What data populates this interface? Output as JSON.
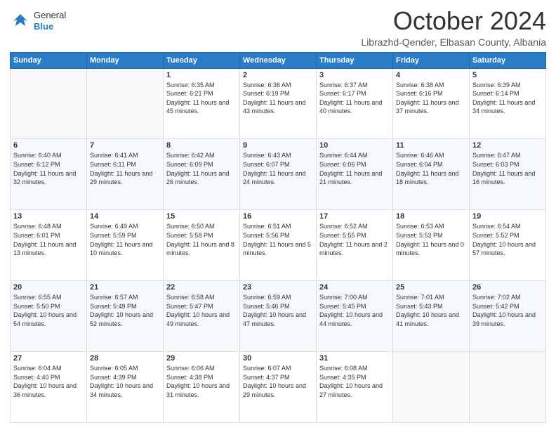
{
  "header": {
    "logo": {
      "general": "General",
      "blue": "Blue"
    },
    "month": "October 2024",
    "location": "Librazhd-Qender, Elbasan County, Albania"
  },
  "days_of_week": [
    "Sunday",
    "Monday",
    "Tuesday",
    "Wednesday",
    "Thursday",
    "Friday",
    "Saturday"
  ],
  "weeks": [
    [
      {
        "day": "",
        "info": ""
      },
      {
        "day": "",
        "info": ""
      },
      {
        "day": "1",
        "info": "Sunrise: 6:35 AM\nSunset: 6:21 PM\nDaylight: 11 hours and 45 minutes."
      },
      {
        "day": "2",
        "info": "Sunrise: 6:36 AM\nSunset: 6:19 PM\nDaylight: 11 hours and 43 minutes."
      },
      {
        "day": "3",
        "info": "Sunrise: 6:37 AM\nSunset: 6:17 PM\nDaylight: 11 hours and 40 minutes."
      },
      {
        "day": "4",
        "info": "Sunrise: 6:38 AM\nSunset: 6:16 PM\nDaylight: 11 hours and 37 minutes."
      },
      {
        "day": "5",
        "info": "Sunrise: 6:39 AM\nSunset: 6:14 PM\nDaylight: 11 hours and 34 minutes."
      }
    ],
    [
      {
        "day": "6",
        "info": "Sunrise: 6:40 AM\nSunset: 6:12 PM\nDaylight: 11 hours and 32 minutes."
      },
      {
        "day": "7",
        "info": "Sunrise: 6:41 AM\nSunset: 6:11 PM\nDaylight: 11 hours and 29 minutes."
      },
      {
        "day": "8",
        "info": "Sunrise: 6:42 AM\nSunset: 6:09 PM\nDaylight: 11 hours and 26 minutes."
      },
      {
        "day": "9",
        "info": "Sunrise: 6:43 AM\nSunset: 6:07 PM\nDaylight: 11 hours and 24 minutes."
      },
      {
        "day": "10",
        "info": "Sunrise: 6:44 AM\nSunset: 6:06 PM\nDaylight: 11 hours and 21 minutes."
      },
      {
        "day": "11",
        "info": "Sunrise: 6:46 AM\nSunset: 6:04 PM\nDaylight: 11 hours and 18 minutes."
      },
      {
        "day": "12",
        "info": "Sunrise: 6:47 AM\nSunset: 6:03 PM\nDaylight: 11 hours and 16 minutes."
      }
    ],
    [
      {
        "day": "13",
        "info": "Sunrise: 6:48 AM\nSunset: 6:01 PM\nDaylight: 11 hours and 13 minutes."
      },
      {
        "day": "14",
        "info": "Sunrise: 6:49 AM\nSunset: 5:59 PM\nDaylight: 11 hours and 10 minutes."
      },
      {
        "day": "15",
        "info": "Sunrise: 6:50 AM\nSunset: 5:58 PM\nDaylight: 11 hours and 8 minutes."
      },
      {
        "day": "16",
        "info": "Sunrise: 6:51 AM\nSunset: 5:56 PM\nDaylight: 11 hours and 5 minutes."
      },
      {
        "day": "17",
        "info": "Sunrise: 6:52 AM\nSunset: 5:55 PM\nDaylight: 11 hours and 2 minutes."
      },
      {
        "day": "18",
        "info": "Sunrise: 6:53 AM\nSunset: 5:53 PM\nDaylight: 11 hours and 0 minutes."
      },
      {
        "day": "19",
        "info": "Sunrise: 6:54 AM\nSunset: 5:52 PM\nDaylight: 10 hours and 57 minutes."
      }
    ],
    [
      {
        "day": "20",
        "info": "Sunrise: 6:55 AM\nSunset: 5:50 PM\nDaylight: 10 hours and 54 minutes."
      },
      {
        "day": "21",
        "info": "Sunrise: 6:57 AM\nSunset: 5:49 PM\nDaylight: 10 hours and 52 minutes."
      },
      {
        "day": "22",
        "info": "Sunrise: 6:58 AM\nSunset: 5:47 PM\nDaylight: 10 hours and 49 minutes."
      },
      {
        "day": "23",
        "info": "Sunrise: 6:59 AM\nSunset: 5:46 PM\nDaylight: 10 hours and 47 minutes."
      },
      {
        "day": "24",
        "info": "Sunrise: 7:00 AM\nSunset: 5:45 PM\nDaylight: 10 hours and 44 minutes."
      },
      {
        "day": "25",
        "info": "Sunrise: 7:01 AM\nSunset: 5:43 PM\nDaylight: 10 hours and 41 minutes."
      },
      {
        "day": "26",
        "info": "Sunrise: 7:02 AM\nSunset: 5:42 PM\nDaylight: 10 hours and 39 minutes."
      }
    ],
    [
      {
        "day": "27",
        "info": "Sunrise: 6:04 AM\nSunset: 4:40 PM\nDaylight: 10 hours and 36 minutes."
      },
      {
        "day": "28",
        "info": "Sunrise: 6:05 AM\nSunset: 4:39 PM\nDaylight: 10 hours and 34 minutes."
      },
      {
        "day": "29",
        "info": "Sunrise: 6:06 AM\nSunset: 4:38 PM\nDaylight: 10 hours and 31 minutes."
      },
      {
        "day": "30",
        "info": "Sunrise: 6:07 AM\nSunset: 4:37 PM\nDaylight: 10 hours and 29 minutes."
      },
      {
        "day": "31",
        "info": "Sunrise: 6:08 AM\nSunset: 4:35 PM\nDaylight: 10 hours and 27 minutes."
      },
      {
        "day": "",
        "info": ""
      },
      {
        "day": "",
        "info": ""
      }
    ]
  ]
}
